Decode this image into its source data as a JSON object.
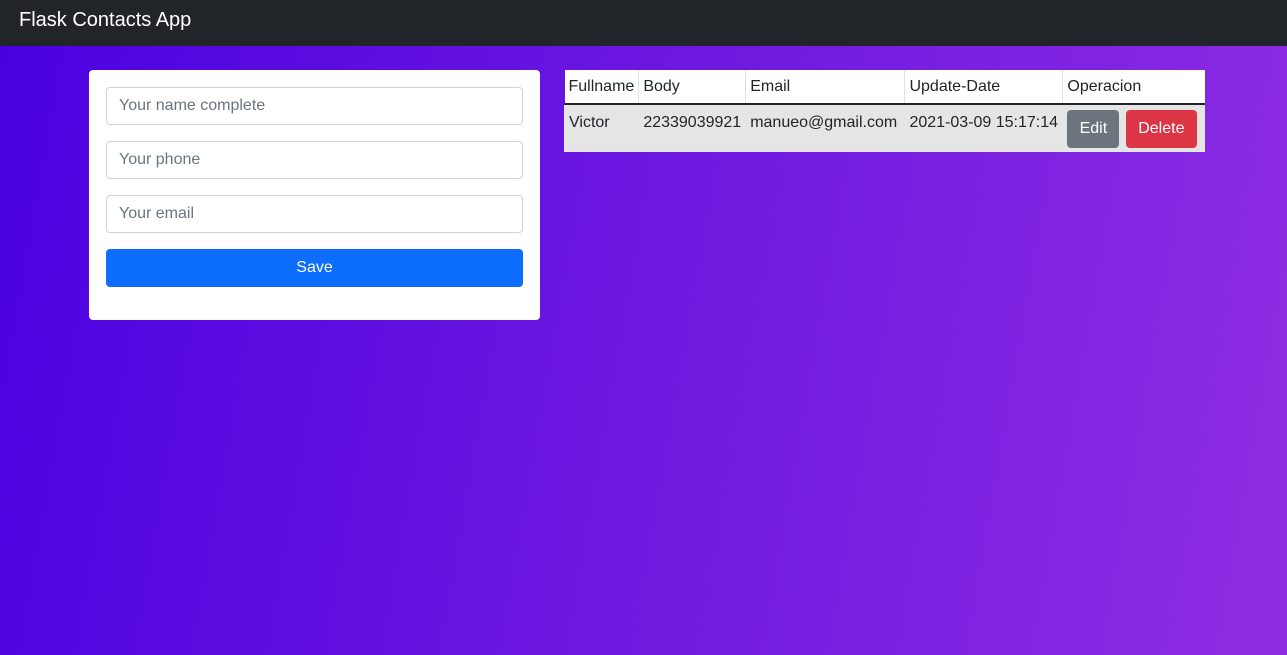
{
  "navbar": {
    "brand": "Flask Contacts App"
  },
  "form": {
    "name_placeholder": "Your name complete",
    "phone_placeholder": "Your phone",
    "email_placeholder": "Your email",
    "save_label": "Save"
  },
  "table": {
    "headers": [
      "Fullname",
      "Body",
      "Email",
      "Update-Date",
      "Operacion"
    ],
    "rows": [
      {
        "fullname": "Victor",
        "body": "22339039921",
        "email": "manueo@gmail.com",
        "update_date": "2021-03-09 15:17:14",
        "edit_label": "Edit",
        "delete_label": "Delete"
      }
    ]
  },
  "colors": {
    "navbar": "#212529",
    "primary": "#0d6efd",
    "secondary": "#6c757d",
    "danger": "#dc3545",
    "gradient_start": "#4a00e0",
    "gradient_end": "#8e2de2"
  }
}
